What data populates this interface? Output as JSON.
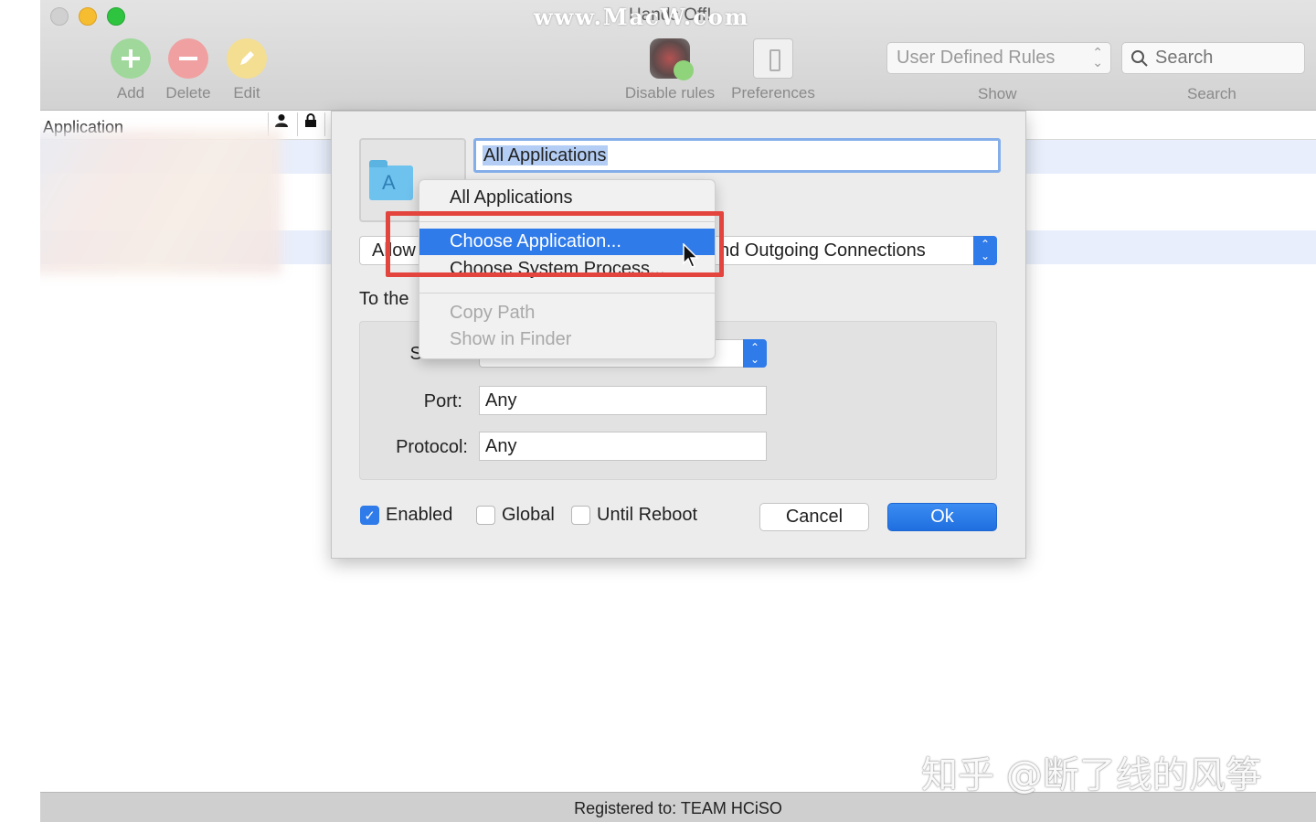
{
  "window": {
    "title": "Hands Off!",
    "watermark": "www.MacW.com"
  },
  "toolbar": {
    "add_label": "Add",
    "delete_label": "Delete",
    "edit_label": "Edit",
    "disable_label": "Disable rules",
    "preferences_label": "Preferences",
    "show_value": "User Defined Rules",
    "show_label": "Show",
    "search_placeholder": "Search",
    "search_label": "Search"
  },
  "table": {
    "col_application": "Application"
  },
  "dialog": {
    "app_name": "All Applications",
    "action_left": "Allow",
    "action_right": "nd Outgoing Connections",
    "to_the": "To the",
    "server_label": "Server:",
    "port_label": "Port:",
    "port_value": "Any",
    "protocol_label": "Protocol:",
    "protocol_value": "Any",
    "enabled_label": "Enabled",
    "global_label": "Global",
    "until_reboot_label": "Until Reboot",
    "cancel_label": "Cancel",
    "ok_label": "Ok"
  },
  "menu": {
    "items": [
      {
        "label": "All Applications",
        "state": "normal"
      },
      {
        "label": "Choose Application...",
        "state": "highlighted"
      },
      {
        "label": "Choose System Process...",
        "state": "normal"
      },
      {
        "label": "Copy Path",
        "state": "disabled"
      },
      {
        "label": "Show in Finder",
        "state": "disabled"
      }
    ]
  },
  "statusbar": {
    "text": "Registered to: TEAM HCiSO"
  },
  "watermark_bottom": "知乎 @断了线的风筝",
  "colors": {
    "accent": "#2f7bea",
    "callout": "#e3453e"
  }
}
